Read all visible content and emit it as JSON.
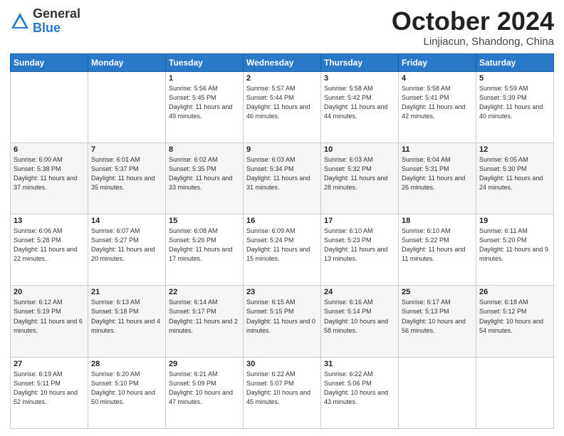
{
  "header": {
    "logo": {
      "general": "General",
      "blue": "Blue"
    },
    "month": "October 2024",
    "location": "Linjiacun, Shandong, China"
  },
  "weekdays": [
    "Sunday",
    "Monday",
    "Tuesday",
    "Wednesday",
    "Thursday",
    "Friday",
    "Saturday"
  ],
  "weeks": [
    [
      {
        "day": "",
        "info": ""
      },
      {
        "day": "",
        "info": ""
      },
      {
        "day": "1",
        "info": "Sunrise: 5:56 AM\nSunset: 5:45 PM\nDaylight: 11 hours and 49 minutes."
      },
      {
        "day": "2",
        "info": "Sunrise: 5:57 AM\nSunset: 5:44 PM\nDaylight: 11 hours and 46 minutes."
      },
      {
        "day": "3",
        "info": "Sunrise: 5:58 AM\nSunset: 5:42 PM\nDaylight: 11 hours and 44 minutes."
      },
      {
        "day": "4",
        "info": "Sunrise: 5:58 AM\nSunset: 5:41 PM\nDaylight: 11 hours and 42 minutes."
      },
      {
        "day": "5",
        "info": "Sunrise: 5:59 AM\nSunset: 5:39 PM\nDaylight: 11 hours and 40 minutes."
      }
    ],
    [
      {
        "day": "6",
        "info": "Sunrise: 6:00 AM\nSunset: 5:38 PM\nDaylight: 11 hours and 37 minutes."
      },
      {
        "day": "7",
        "info": "Sunrise: 6:01 AM\nSunset: 5:37 PM\nDaylight: 11 hours and 35 minutes."
      },
      {
        "day": "8",
        "info": "Sunrise: 6:02 AM\nSunset: 5:35 PM\nDaylight: 11 hours and 33 minutes."
      },
      {
        "day": "9",
        "info": "Sunrise: 6:03 AM\nSunset: 5:34 PM\nDaylight: 11 hours and 31 minutes."
      },
      {
        "day": "10",
        "info": "Sunrise: 6:03 AM\nSunset: 5:32 PM\nDaylight: 11 hours and 28 minutes."
      },
      {
        "day": "11",
        "info": "Sunrise: 6:04 AM\nSunset: 5:31 PM\nDaylight: 11 hours and 26 minutes."
      },
      {
        "day": "12",
        "info": "Sunrise: 6:05 AM\nSunset: 5:30 PM\nDaylight: 11 hours and 24 minutes."
      }
    ],
    [
      {
        "day": "13",
        "info": "Sunrise: 6:06 AM\nSunset: 5:28 PM\nDaylight: 11 hours and 22 minutes."
      },
      {
        "day": "14",
        "info": "Sunrise: 6:07 AM\nSunset: 5:27 PM\nDaylight: 11 hours and 20 minutes."
      },
      {
        "day": "15",
        "info": "Sunrise: 6:08 AM\nSunset: 5:26 PM\nDaylight: 11 hours and 17 minutes."
      },
      {
        "day": "16",
        "info": "Sunrise: 6:09 AM\nSunset: 5:24 PM\nDaylight: 11 hours and 15 minutes."
      },
      {
        "day": "17",
        "info": "Sunrise: 6:10 AM\nSunset: 5:23 PM\nDaylight: 11 hours and 13 minutes."
      },
      {
        "day": "18",
        "info": "Sunrise: 6:10 AM\nSunset: 5:22 PM\nDaylight: 11 hours and 11 minutes."
      },
      {
        "day": "19",
        "info": "Sunrise: 6:11 AM\nSunset: 5:20 PM\nDaylight: 11 hours and 9 minutes."
      }
    ],
    [
      {
        "day": "20",
        "info": "Sunrise: 6:12 AM\nSunset: 5:19 PM\nDaylight: 11 hours and 6 minutes."
      },
      {
        "day": "21",
        "info": "Sunrise: 6:13 AM\nSunset: 5:18 PM\nDaylight: 11 hours and 4 minutes."
      },
      {
        "day": "22",
        "info": "Sunrise: 6:14 AM\nSunset: 5:17 PM\nDaylight: 11 hours and 2 minutes."
      },
      {
        "day": "23",
        "info": "Sunrise: 6:15 AM\nSunset: 5:15 PM\nDaylight: 11 hours and 0 minutes."
      },
      {
        "day": "24",
        "info": "Sunrise: 6:16 AM\nSunset: 5:14 PM\nDaylight: 10 hours and 58 minutes."
      },
      {
        "day": "25",
        "info": "Sunrise: 6:17 AM\nSunset: 5:13 PM\nDaylight: 10 hours and 56 minutes."
      },
      {
        "day": "26",
        "info": "Sunrise: 6:18 AM\nSunset: 5:12 PM\nDaylight: 10 hours and 54 minutes."
      }
    ],
    [
      {
        "day": "27",
        "info": "Sunrise: 6:19 AM\nSunset: 5:11 PM\nDaylight: 10 hours and 52 minutes."
      },
      {
        "day": "28",
        "info": "Sunrise: 6:20 AM\nSunset: 5:10 PM\nDaylight: 10 hours and 50 minutes."
      },
      {
        "day": "29",
        "info": "Sunrise: 6:21 AM\nSunset: 5:09 PM\nDaylight: 10 hours and 47 minutes."
      },
      {
        "day": "30",
        "info": "Sunrise: 6:22 AM\nSunset: 5:07 PM\nDaylight: 10 hours and 45 minutes."
      },
      {
        "day": "31",
        "info": "Sunrise: 6:22 AM\nSunset: 5:06 PM\nDaylight: 10 hours and 43 minutes."
      },
      {
        "day": "",
        "info": ""
      },
      {
        "day": "",
        "info": ""
      }
    ]
  ]
}
